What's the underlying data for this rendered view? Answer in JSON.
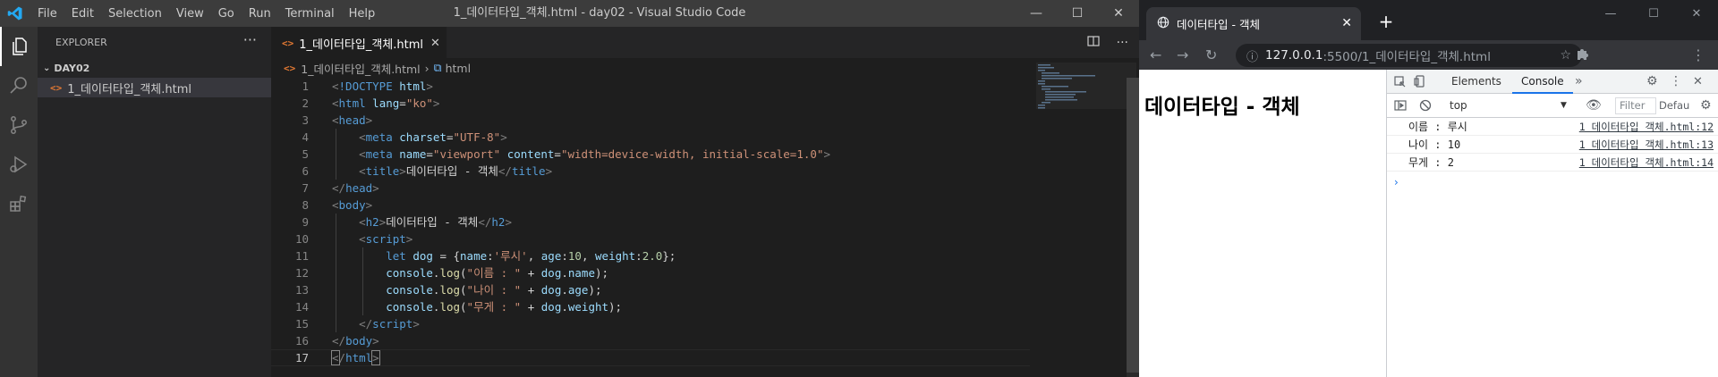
{
  "vscode": {
    "menu": [
      "File",
      "Edit",
      "Selection",
      "View",
      "Go",
      "Run",
      "Terminal",
      "Help"
    ],
    "window_title": "1_데이터타입_객체.html - day02 - Visual Studio Code",
    "explorer_title": "EXPLORER",
    "folder": "DAY02",
    "file": "1_데이터타입_객체.html",
    "tab_label": "1_데이터타입_객체.html",
    "breadcrumb": {
      "file": "1_데이터타입_객체.html",
      "symbol": "html"
    },
    "line_numbers": [
      "1",
      "2",
      "3",
      "4",
      "5",
      "6",
      "7",
      "8",
      "9",
      "10",
      "11",
      "12",
      "13",
      "14",
      "15",
      "16",
      "17"
    ]
  },
  "chrome": {
    "tab_title": "데이터타입 - 객체",
    "url_host": "127.0.0.1",
    "url_path": ":5500/1_데이터타입_객체.html",
    "page_heading": "데이터타입 - 객체",
    "devtools": {
      "tabs": [
        "Elements",
        "Console"
      ],
      "context": "top",
      "filter_placeholder": "Filter",
      "levels": "Defau",
      "console_lines": [
        {
          "msg": "이름 : 루시",
          "src": "1 데이터타입 객체.html:12"
        },
        {
          "msg": "나이 : 10",
          "src": "1 데이터타입 객체.html:13"
        },
        {
          "msg": "무게 : 2",
          "src": "1 데이터타입 객체.html:14"
        }
      ],
      "prompt": "›"
    }
  },
  "colors": {
    "vscode_accent": "#007acc",
    "chrome_tab": "#35363a",
    "devtools_active": "#1a73e8"
  }
}
